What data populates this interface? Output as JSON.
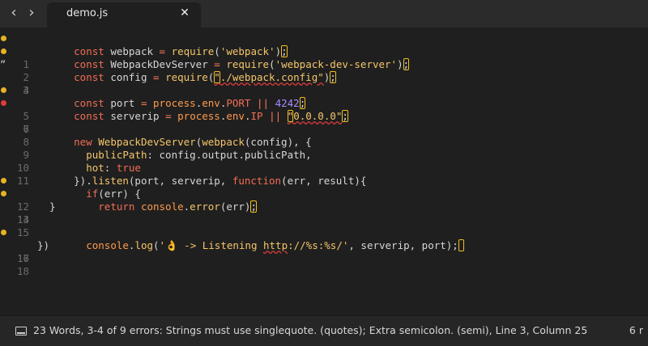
{
  "tabbar": {
    "back_icon": "chevron-left-icon",
    "forward_icon": "chevron-right-icon",
    "tab_title": "demo.js",
    "close_icon": "close-icon"
  },
  "editor": {
    "lines": [
      {
        "num": "1",
        "mark": "warn",
        "code": "const webpack = require('webpack');"
      },
      {
        "num": "2",
        "mark": "warn",
        "code": "const WebpackDevServer = require('webpack-dev-server');"
      },
      {
        "num": "3",
        "mark": "quote",
        "code": "const config = require(\"./webpack.config\");"
      },
      {
        "num": "4",
        "mark": "",
        "code": ""
      },
      {
        "num": "5",
        "mark": "warn",
        "code": "const port = process.env.PORT || 4242;"
      },
      {
        "num": "6",
        "mark": "err",
        "code": "const serverip = process.env.IP || \"0.0.0.0\";"
      },
      {
        "num": "7",
        "mark": "",
        "code": ""
      },
      {
        "num": "8",
        "mark": "",
        "code": "new WebpackDevServer(webpack(config), {"
      },
      {
        "num": "9",
        "mark": "",
        "code": "  publicPath: config.output.publicPath,"
      },
      {
        "num": "10",
        "mark": "",
        "code": "  hot: true"
      },
      {
        "num": "11",
        "mark": "",
        "code": "}).listen(port, serverip, function(err, result){"
      },
      {
        "num": "12",
        "mark": "warn",
        "code": "  if(err) {"
      },
      {
        "num": "13",
        "mark": "warn",
        "code": "    return console.error(err);"
      },
      {
        "num": "14",
        "mark": "",
        "code": "  }"
      },
      {
        "num": "15",
        "mark": "",
        "code": ""
      },
      {
        "num": "16",
        "mark": "warn",
        "code": "  console.log('👌 -> Listening http://%s:%s/', serverip, port);"
      },
      {
        "num": "17",
        "mark": "",
        "code": "})"
      },
      {
        "num": "18",
        "mark": "",
        "code": ""
      }
    ]
  },
  "status": {
    "icon": "panel-toggle-icon",
    "text": "23 Words, 3-4 of 9 errors: Strings must use singlequote. (quotes); Extra semicolon. (semi), Line 3, Column 25",
    "right_text": "6 r"
  },
  "colors": {
    "background": "#1f1f1f",
    "tabbar": "#2b2b2b",
    "keyword": "#f26d55",
    "function": "#f5c66a",
    "number": "#a98bff",
    "property": "#ff9a4d",
    "warning": "#e6b422",
    "error": "#e03b3b"
  }
}
